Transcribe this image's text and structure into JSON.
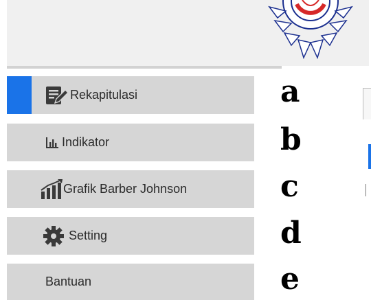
{
  "menu": {
    "items": [
      {
        "label": "Rekapitulasi",
        "icon": "edit-document-icon",
        "active": true
      },
      {
        "label": "Indikator",
        "icon": "bar-chart-icon",
        "active": false
      },
      {
        "label": "Grafik Barber Johnson",
        "icon": "growth-chart-icon",
        "active": false
      },
      {
        "label": "Setting",
        "icon": "gear-icon",
        "active": false
      },
      {
        "label": "Bantuan",
        "icon": "",
        "active": false
      }
    ]
  },
  "annotations": {
    "letters": [
      "a",
      "b",
      "c",
      "d",
      "e"
    ]
  },
  "colors": {
    "active_accent": "#1a73e8",
    "menu_bg": "#d6d6d6",
    "topbar_bg": "#f0f0f0",
    "logo_red": "#d62828",
    "logo_blue": "#1b2f8f"
  }
}
